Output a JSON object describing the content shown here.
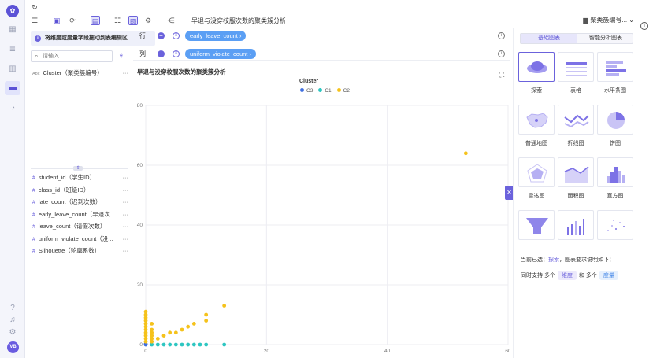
{
  "toolbar": {
    "chart_title": "早退与没穿校服次数的聚类簇分析",
    "dataset_name": "聚类簇编号..."
  },
  "field_panel": {
    "hint": "将维度或度量字段拖动到表编辑区",
    "search_placeholder": "请输入",
    "dimensions": [
      {
        "type": "Abc",
        "label": "Cluster（聚类簇编号）"
      }
    ],
    "measures": [
      {
        "type": "#",
        "label": "student_id（学生ID）"
      },
      {
        "type": "#",
        "label": "class_id（班级ID）"
      },
      {
        "type": "#",
        "label": "late_count（迟到次数）"
      },
      {
        "type": "#",
        "label": "early_leave_count（早退次..."
      },
      {
        "type": "#",
        "label": "leave_count（请假次数）"
      },
      {
        "type": "#",
        "label": "uniform_violate_count（没..."
      },
      {
        "type": "#",
        "label": "Silhouette（轮廓系数）"
      }
    ]
  },
  "shelves": {
    "row_label": "行",
    "row_pill": "early_leave_count",
    "col_label": "列",
    "col_pill": "uniform_violate_count"
  },
  "chart_data": {
    "type": "scatter",
    "title": "早退与没穿校服次数的聚类簇分析",
    "legend_title": "Cluster",
    "xlim": [
      0,
      60
    ],
    "ylim": [
      0,
      80
    ],
    "x_ticks": [
      0,
      20,
      40,
      60
    ],
    "y_ticks": [
      0,
      20,
      40,
      60,
      80
    ],
    "grid": true,
    "legend_position": "top-center",
    "series": [
      {
        "name": "C3",
        "color": "#3f6fe0",
        "points": [
          [
            0,
            0
          ],
          [
            0,
            0.2
          ]
        ]
      },
      {
        "name": "C1",
        "color": "#2ec6c1",
        "points": [
          [
            1,
            0
          ],
          [
            2,
            0
          ],
          [
            3,
            0
          ],
          [
            4,
            0
          ],
          [
            5,
            0
          ],
          [
            6,
            0
          ],
          [
            7,
            0
          ],
          [
            8,
            0
          ],
          [
            9,
            0
          ],
          [
            10,
            0
          ],
          [
            13,
            0
          ]
        ]
      },
      {
        "name": "C2",
        "color": "#f5c21b",
        "points": [
          [
            0,
            1
          ],
          [
            0,
            2
          ],
          [
            0,
            3
          ],
          [
            0,
            4
          ],
          [
            0,
            5
          ],
          [
            0,
            6
          ],
          [
            0,
            7
          ],
          [
            0,
            8
          ],
          [
            0,
            9
          ],
          [
            0,
            10
          ],
          [
            0,
            11
          ],
          [
            1,
            1
          ],
          [
            1,
            2
          ],
          [
            1,
            3
          ],
          [
            1,
            4
          ],
          [
            1,
            5
          ],
          [
            1,
            7
          ],
          [
            2,
            2
          ],
          [
            3,
            3
          ],
          [
            4,
            4
          ],
          [
            5,
            4
          ],
          [
            6,
            5
          ],
          [
            7,
            6
          ],
          [
            8,
            7
          ],
          [
            10,
            10
          ],
          [
            10,
            8
          ],
          [
            13,
            13
          ],
          [
            53,
            64
          ]
        ]
      }
    ]
  },
  "right_panel": {
    "tab_basic": "基础图表",
    "tab_smart": "智能分析图表",
    "chart_types": [
      "探索",
      "表格",
      "水平条图",
      "普通地图",
      "折线图",
      "饼图",
      "雷达图",
      "面积图",
      "直方图"
    ],
    "requirement_prefix": "当前已选：",
    "requirement_selected": "探索",
    "requirement_suffix": "，图表要求说明如下：",
    "support_prefix": "同时支持 多个",
    "support_dim": "维度",
    "support_mid": "和 多个",
    "support_measure": "度量"
  }
}
